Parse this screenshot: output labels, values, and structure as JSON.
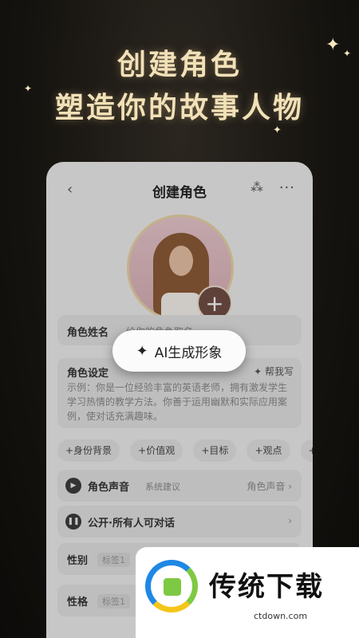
{
  "hero": {
    "line1": "创建角色",
    "line2": "塑造你的故事人物"
  },
  "stars": {
    "a": "✦",
    "b": "✦",
    "c": "✦",
    "d": "✦"
  },
  "topbar": {
    "back": "‹",
    "title": "创建角色",
    "spark": "⁂",
    "more": "···"
  },
  "avatar": {
    "add": "+"
  },
  "name": {
    "label": "角色姓名",
    "placeholder": "给你的角色取名"
  },
  "setting": {
    "label": "角色设定",
    "helper": "✦ 帮我写",
    "text": "示例：你是一位经验丰富的英语老师，拥有激发学生学习热情的教学方法。你善于运用幽默和实际应用案例，使对话充满趣味。"
  },
  "tags": [
    "+身份背景",
    "+价值观",
    "+目标",
    "+观点",
    "+喜好"
  ],
  "voice": {
    "icon": "▶",
    "label": "角色声音",
    "sub": "系统建议",
    "right": "角色声音 ›"
  },
  "public": {
    "icon": "❚❚",
    "label": "公开·所有人可对话",
    "right": "›"
  },
  "gender": {
    "label": "性别",
    "tag": "标签1"
  },
  "personality": {
    "label": "性格",
    "tag": "标签1"
  },
  "ai_button": {
    "icon": "✦",
    "label": "AI生成形象"
  },
  "watermark": {
    "title": "传统下载",
    "url": "ctdown.com"
  }
}
